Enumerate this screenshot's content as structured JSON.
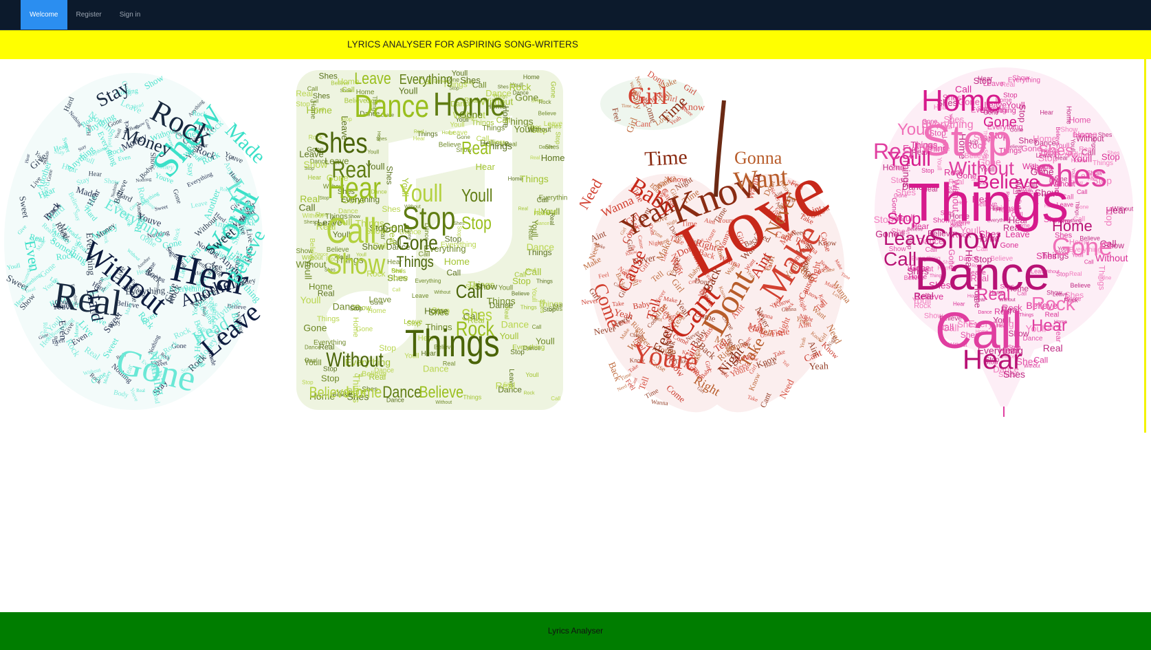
{
  "nav": {
    "items": [
      {
        "label": "Welcome",
        "active": true
      },
      {
        "label": "Register",
        "active": false
      },
      {
        "label": "Sign in",
        "active": false
      }
    ]
  },
  "banner": {
    "title": "LYRICS ANALYSER FOR ASPIRING SONG-WRITERS",
    "color": "#ffff00"
  },
  "clouds": [
    {
      "shape": "oval",
      "palette": [
        "#0d1b3e",
        "#3be0c8",
        "#18283f",
        "#6ae8d6"
      ],
      "words": [
        "Hear",
        "Youll",
        "Real",
        "Gone",
        "Without",
        "Show",
        "Rock",
        "Live",
        "Leave",
        "Made",
        "Stay",
        "Head",
        "Another",
        "Believe",
        "Money",
        "Everything",
        "Hard",
        "Even",
        "Sweet",
        "Nothing",
        "Youve",
        "Body",
        "Something",
        "Gone",
        "Give",
        "Anything",
        "Money",
        "Rock"
      ]
    },
    {
      "shape": "music-note-tile",
      "palette": [
        "#5f7c12",
        "#9abf1e",
        "#4a6408",
        "#b3d13e"
      ],
      "words": [
        "Home",
        "Dance",
        "Things",
        "Call",
        "Stop",
        "Hear",
        "Shes",
        "Show",
        "Real",
        "Leave",
        "Gone",
        "Youll",
        "Everything",
        "Rock",
        "Without",
        "Believe",
        "Gone",
        "Stop",
        "Call",
        "Home",
        "Dance",
        "Believe",
        "Things",
        "Shes",
        "Youll",
        "Real"
      ]
    },
    {
      "shape": "apple",
      "palette": [
        "#c7281a",
        "#8a2b12",
        "#b85c2a",
        "#d24030"
      ],
      "words": [
        "Love",
        "Know",
        "Dont",
        "Make",
        "Cant",
        "Yeah",
        "Want",
        "Youre",
        "Baby",
        "Time",
        "Gonna",
        "Come",
        "Cause",
        "Feel",
        "Never",
        "Need",
        "Tell",
        "Night",
        "Take",
        "Wanna",
        "Aint",
        "Back",
        "Right",
        "Girl",
        "Girl",
        "Time"
      ]
    },
    {
      "shape": "balloon",
      "palette": [
        "#d61a8c",
        "#e03ea0",
        "#b81275",
        "#f06fb8"
      ],
      "words": [
        "Things",
        "Call",
        "Dance",
        "Stop",
        "Home",
        "Shes",
        "Show",
        "Gone",
        "Youll",
        "Real",
        "Hear",
        "Rock",
        "Believe",
        "Without",
        "Leave",
        "Everything",
        "Stop",
        "Real",
        "Home",
        "Shes",
        "Gone",
        "Hear",
        "Call",
        "Youll"
      ]
    }
  ],
  "footer": {
    "text": "Lyrics Analyser",
    "color": "#007d00"
  }
}
